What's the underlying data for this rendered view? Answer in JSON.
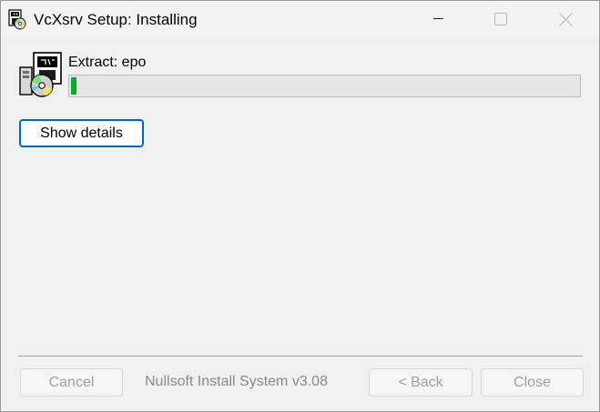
{
  "window": {
    "title": "VcXsrv Setup: Installing"
  },
  "progress": {
    "status_text": "Extract: epo",
    "fraction": 0.01
  },
  "buttons": {
    "show_details": "Show details",
    "cancel": "Cancel",
    "back": "< Back",
    "close": "Close"
  },
  "branding": {
    "text": "Nullsoft Install System v3.08"
  },
  "icons": {
    "app": "installer-icon",
    "minimize": "minimize-icon",
    "maximize": "maximize-icon",
    "close": "close-icon"
  },
  "colors": {
    "progress_fill": "#06b025",
    "accent_border": "#0067c0"
  }
}
